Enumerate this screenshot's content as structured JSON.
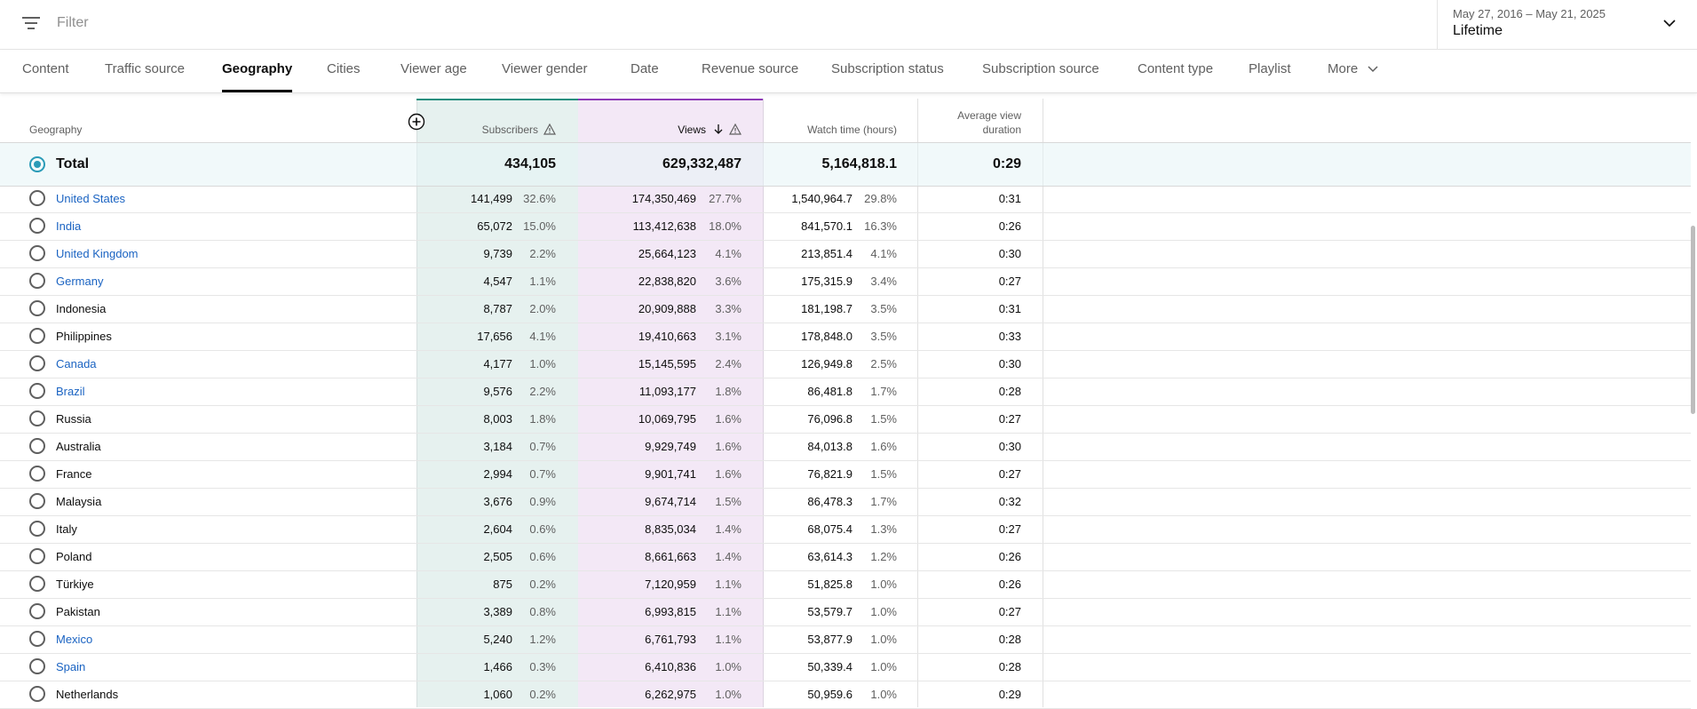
{
  "topbar": {
    "filter_placeholder": "Filter",
    "filter_icon": "filter-lines-icon",
    "date_range": "May 27, 2016 – May 21, 2025",
    "date_label": "Lifetime",
    "date_chevron_icon": "chevron-down-icon"
  },
  "tabs": [
    {
      "label": "Content",
      "active": false
    },
    {
      "label": "Traffic source",
      "active": false
    },
    {
      "label": "Geography",
      "active": true
    },
    {
      "label": "Cities",
      "active": false
    },
    {
      "label": "Viewer age",
      "active": false
    },
    {
      "label": "Viewer gender",
      "active": false
    },
    {
      "label": "Date",
      "active": false
    },
    {
      "label": "Revenue source",
      "active": false
    },
    {
      "label": "Subscription status",
      "active": false
    },
    {
      "label": "Subscription source",
      "active": false
    },
    {
      "label": "Content type",
      "active": false
    },
    {
      "label": "Playlist",
      "active": false
    },
    {
      "label": "More",
      "active": false
    }
  ],
  "table": {
    "headers": {
      "geography": "Geography",
      "subscribers": "Subscribers",
      "views": "Views",
      "watch_time": "Watch time (hours)",
      "avg_view_duration_line1": "Average view",
      "avg_view_duration_line2": "duration"
    },
    "colors": {
      "subscribers_accent": "#1e8e7e",
      "views_accent": "#8e3ab7",
      "link": "#1a63c2",
      "radio_selected": "#2a9bb7"
    },
    "total": {
      "label": "Total",
      "subscribers": "434,105",
      "views": "629,332,487",
      "watch_time": "5,164,818.1",
      "avg_duration": "0:29"
    },
    "rows": [
      {
        "name": "United States",
        "link": true,
        "subs": "141,499",
        "subs_pct": "32.6%",
        "views": "174,350,469",
        "views_pct": "27.7%",
        "watch": "1,540,964.7",
        "watch_pct": "29.8%",
        "avg": "0:31"
      },
      {
        "name": "India",
        "link": true,
        "subs": "65,072",
        "subs_pct": "15.0%",
        "views": "113,412,638",
        "views_pct": "18.0%",
        "watch": "841,570.1",
        "watch_pct": "16.3%",
        "avg": "0:26"
      },
      {
        "name": "United Kingdom",
        "link": true,
        "subs": "9,739",
        "subs_pct": "2.2%",
        "views": "25,664,123",
        "views_pct": "4.1%",
        "watch": "213,851.4",
        "watch_pct": "4.1%",
        "avg": "0:30"
      },
      {
        "name": "Germany",
        "link": true,
        "subs": "4,547",
        "subs_pct": "1.1%",
        "views": "22,838,820",
        "views_pct": "3.6%",
        "watch": "175,315.9",
        "watch_pct": "3.4%",
        "avg": "0:27"
      },
      {
        "name": "Indonesia",
        "link": false,
        "subs": "8,787",
        "subs_pct": "2.0%",
        "views": "20,909,888",
        "views_pct": "3.3%",
        "watch": "181,198.7",
        "watch_pct": "3.5%",
        "avg": "0:31"
      },
      {
        "name": "Philippines",
        "link": false,
        "subs": "17,656",
        "subs_pct": "4.1%",
        "views": "19,410,663",
        "views_pct": "3.1%",
        "watch": "178,848.0",
        "watch_pct": "3.5%",
        "avg": "0:33"
      },
      {
        "name": "Canada",
        "link": true,
        "subs": "4,177",
        "subs_pct": "1.0%",
        "views": "15,145,595",
        "views_pct": "2.4%",
        "watch": "126,949.8",
        "watch_pct": "2.5%",
        "avg": "0:30"
      },
      {
        "name": "Brazil",
        "link": true,
        "subs": "9,576",
        "subs_pct": "2.2%",
        "views": "11,093,177",
        "views_pct": "1.8%",
        "watch": "86,481.8",
        "watch_pct": "1.7%",
        "avg": "0:28"
      },
      {
        "name": "Russia",
        "link": false,
        "subs": "8,003",
        "subs_pct": "1.8%",
        "views": "10,069,795",
        "views_pct": "1.6%",
        "watch": "76,096.8",
        "watch_pct": "1.5%",
        "avg": "0:27"
      },
      {
        "name": "Australia",
        "link": false,
        "subs": "3,184",
        "subs_pct": "0.7%",
        "views": "9,929,749",
        "views_pct": "1.6%",
        "watch": "84,013.8",
        "watch_pct": "1.6%",
        "avg": "0:30"
      },
      {
        "name": "France",
        "link": false,
        "subs": "2,994",
        "subs_pct": "0.7%",
        "views": "9,901,741",
        "views_pct": "1.6%",
        "watch": "76,821.9",
        "watch_pct": "1.5%",
        "avg": "0:27"
      },
      {
        "name": "Malaysia",
        "link": false,
        "subs": "3,676",
        "subs_pct": "0.9%",
        "views": "9,674,714",
        "views_pct": "1.5%",
        "watch": "86,478.3",
        "watch_pct": "1.7%",
        "avg": "0:32"
      },
      {
        "name": "Italy",
        "link": false,
        "subs": "2,604",
        "subs_pct": "0.6%",
        "views": "8,835,034",
        "views_pct": "1.4%",
        "watch": "68,075.4",
        "watch_pct": "1.3%",
        "avg": "0:27"
      },
      {
        "name": "Poland",
        "link": false,
        "subs": "2,505",
        "subs_pct": "0.6%",
        "views": "8,661,663",
        "views_pct": "1.4%",
        "watch": "63,614.3",
        "watch_pct": "1.2%",
        "avg": "0:26"
      },
      {
        "name": "Türkiye",
        "link": false,
        "subs": "875",
        "subs_pct": "0.2%",
        "views": "7,120,959",
        "views_pct": "1.1%",
        "watch": "51,825.8",
        "watch_pct": "1.0%",
        "avg": "0:26"
      },
      {
        "name": "Pakistan",
        "link": false,
        "subs": "3,389",
        "subs_pct": "0.8%",
        "views": "6,993,815",
        "views_pct": "1.1%",
        "watch": "53,579.7",
        "watch_pct": "1.0%",
        "avg": "0:27"
      },
      {
        "name": "Mexico",
        "link": true,
        "subs": "5,240",
        "subs_pct": "1.2%",
        "views": "6,761,793",
        "views_pct": "1.1%",
        "watch": "53,877.9",
        "watch_pct": "1.0%",
        "avg": "0:28"
      },
      {
        "name": "Spain",
        "link": true,
        "subs": "1,466",
        "subs_pct": "0.3%",
        "views": "6,410,836",
        "views_pct": "1.0%",
        "watch": "50,339.4",
        "watch_pct": "1.0%",
        "avg": "0:28"
      },
      {
        "name": "Netherlands",
        "link": false,
        "subs": "1,060",
        "subs_pct": "0.2%",
        "views": "6,262,975",
        "views_pct": "1.0%",
        "watch": "50,959.6",
        "watch_pct": "1.0%",
        "avg": "0:29"
      }
    ]
  }
}
